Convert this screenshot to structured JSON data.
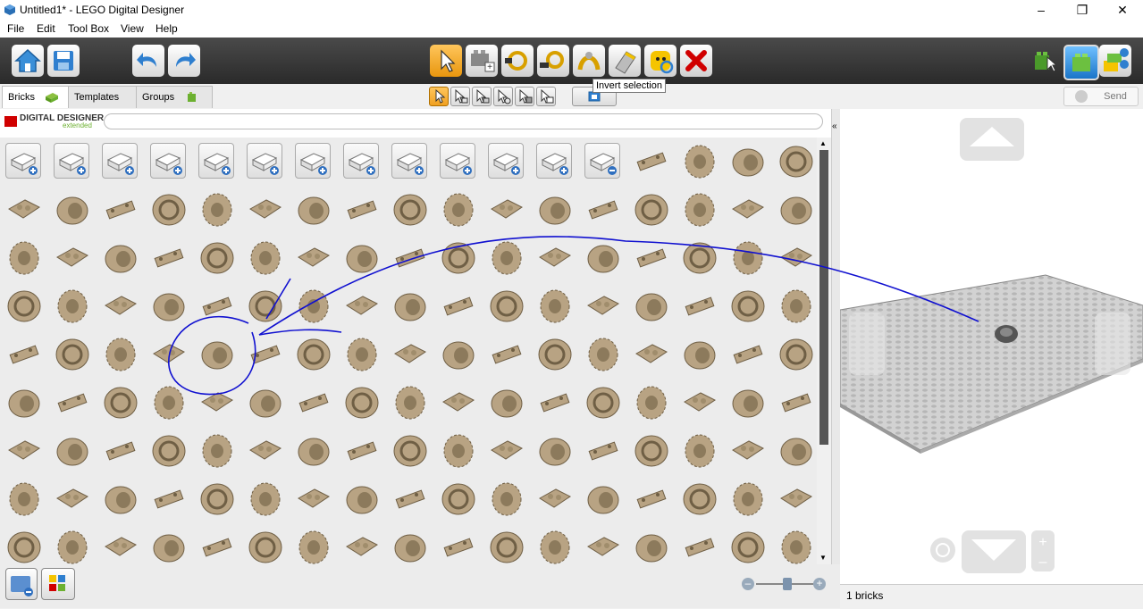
{
  "window": {
    "title": "Untitled1* - LEGO Digital Designer"
  },
  "menu": [
    "File",
    "Edit",
    "Tool Box",
    "View",
    "Help"
  ],
  "tabs": [
    {
      "label": "Bricks"
    },
    {
      "label": "Templates"
    },
    {
      "label": "Groups"
    }
  ],
  "tooltip": "Invert selection",
  "send_label": "Send",
  "brand": {
    "line1": "DIGITAL DESIGNER",
    "line2": "extended"
  },
  "search": {
    "placeholder": ""
  },
  "status": "1 bricks",
  "colors": {
    "toolbar": "#333333",
    "part": "#b8a383",
    "annotation": "#1010d0",
    "accent": "#f0a020"
  },
  "toolbar_icons": [
    "home-icon",
    "save-icon",
    "undo-icon",
    "redo-icon",
    "select-tool-icon",
    "clone-tool-icon",
    "hinge-tool-icon",
    "hinge-align-tool-icon",
    "flex-tool-icon",
    "paint-tool-icon",
    "hide-tool-icon",
    "delete-tool-icon",
    "build-mode-icon",
    "view-mode-icon",
    "building-guide-icon"
  ],
  "selection_icons": [
    "single-select-icon",
    "select-connected-icon",
    "select-same-color-icon",
    "select-same-shape-icon",
    "select-same-color-shape-icon",
    "invert-selection-icon"
  ],
  "palette": {
    "category_count": 13,
    "columns": 17,
    "rows": 9
  }
}
